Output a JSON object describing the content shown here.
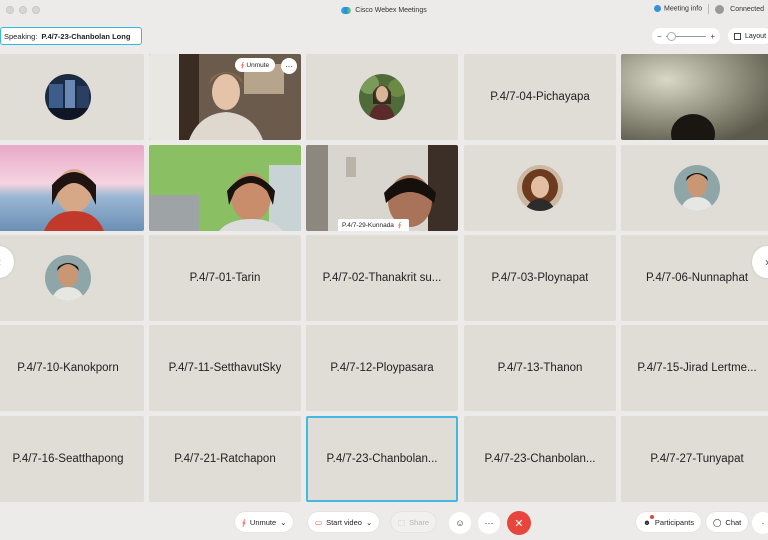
{
  "window": {
    "title": "Cisco Webex Meetings",
    "meeting_info": "Meeting info",
    "status": "Connected"
  },
  "speaking": {
    "label": "Speaking:",
    "name": "P.4/7-23-Chanbolan Long"
  },
  "toolbar": {
    "zoom_out": "−",
    "zoom_in": "+",
    "layout": "Layout"
  },
  "tiles": [
    {
      "type": "avatar",
      "name": "",
      "photo": "room"
    },
    {
      "type": "video",
      "name": "",
      "photo": "teacher"
    },
    {
      "type": "avatar",
      "name": "",
      "photo": "woman-garden"
    },
    {
      "type": "name",
      "name": "P.4/7-04-Pichayapa"
    },
    {
      "type": "video",
      "name": "",
      "photo": "dark-room"
    },
    {
      "type": "video",
      "name": "",
      "photo": "beach-girl"
    },
    {
      "type": "video",
      "name": "",
      "photo": "green-wall"
    },
    {
      "type": "video",
      "name": "P.4/7-29-Kunnada",
      "photo": "boy-room"
    },
    {
      "type": "avatar",
      "name": "",
      "photo": "curly-hair"
    },
    {
      "type": "avatar",
      "name": "",
      "photo": "boy-portrait"
    },
    {
      "type": "avatar",
      "name": "",
      "photo": "boy-portrait"
    },
    {
      "type": "name",
      "name": "P.4/7-01-Tarin"
    },
    {
      "type": "name",
      "name": "P.4/7-02-Thanakrit su..."
    },
    {
      "type": "name",
      "name": "P.4/7-03-Ploynapat"
    },
    {
      "type": "name",
      "name": "P.4/7-06-Nunnaphat"
    },
    {
      "type": "name",
      "name": "P.4/7-10-Kanokporn"
    },
    {
      "type": "name",
      "name": "P.4/7-11-SetthavutSky"
    },
    {
      "type": "name",
      "name": "P.4/7-12-Ploypasara"
    },
    {
      "type": "name",
      "name": "P.4/7-13-Thanon"
    },
    {
      "type": "name",
      "name": "P.4/7-15-Jirad Lertme..."
    },
    {
      "type": "name",
      "name": "P.4/7-16-Seatthapong"
    },
    {
      "type": "name",
      "name": "P.4/7-21-Ratchapon"
    },
    {
      "type": "name",
      "name": "P.4/7-23-Chanbolan...",
      "active": true
    },
    {
      "type": "name",
      "name": "P.4/7-23-Chanbolan..."
    },
    {
      "type": "name",
      "name": "P.4/7-27-Tunyapat"
    }
  ],
  "tile_controls": {
    "unmute": "Unmute",
    "more": "···"
  },
  "bottom": {
    "unmute": "Unmute",
    "start_video": "Start video",
    "share": "Share",
    "participants": "Participants",
    "chat": "Chat"
  },
  "colors": {
    "accent": "#45b8e0",
    "end_call": "#e8453c",
    "tile_bg": "#e0dcd6",
    "background": "#ecebe9"
  }
}
